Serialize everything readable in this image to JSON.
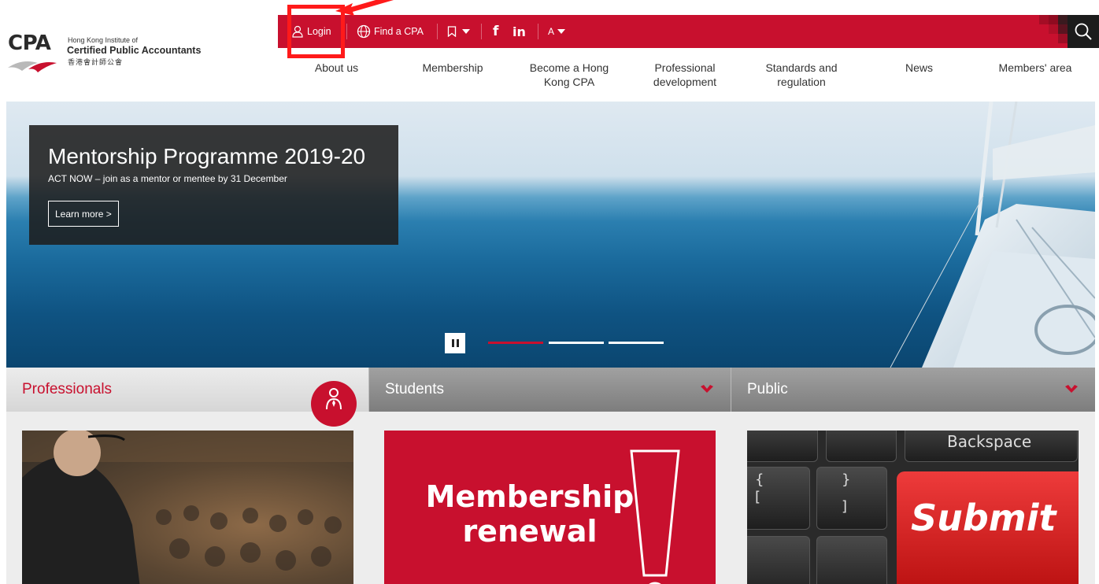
{
  "logo": {
    "mark": "CPA",
    "line1": "Hong Kong Institute of",
    "line2": "Certified Public Accountants",
    "line3": "香港會計師公會"
  },
  "utility_bar": {
    "login_label": "Login",
    "find_cpa_label": "Find a CPA",
    "facebook_label": "f",
    "linkedin_label": "in",
    "font_size_label": "A",
    "accent_color": "#c8102e"
  },
  "nav": {
    "items": [
      {
        "label": "About us"
      },
      {
        "label": "Membership"
      },
      {
        "label": "Become a Hong Kong CPA"
      },
      {
        "label": "Professional development"
      },
      {
        "label": "Standards and regulation"
      },
      {
        "label": "News"
      },
      {
        "label": "Members' area"
      }
    ]
  },
  "hero": {
    "title": "Mentorship Programme 2019-20",
    "subtitle": "ACT NOW – join as a mentor or mentee by 31 December",
    "cta_label": "Learn more >",
    "slides_total": 3,
    "active_slide": 1
  },
  "audience_tabs": [
    {
      "label": "Professionals"
    },
    {
      "label": "Students"
    },
    {
      "label": "Public"
    }
  ],
  "cards": {
    "renewal_line1": "Membership",
    "renewal_line2": "renewal",
    "submit_key": "Submit",
    "backspace_key": "Backspace"
  }
}
